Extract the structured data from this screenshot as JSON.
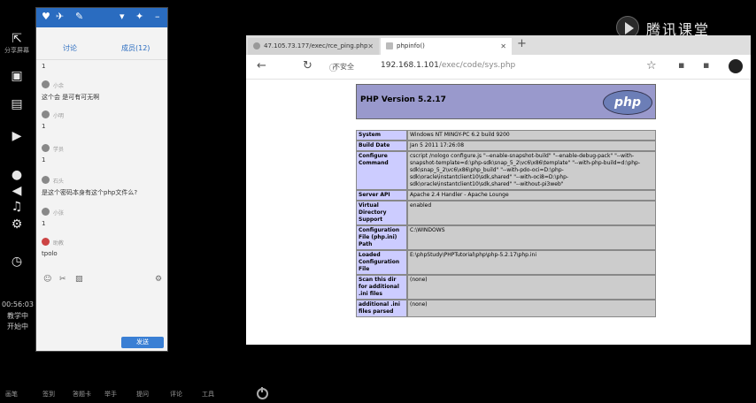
{
  "left_toolbar": {
    "share_label": "分享屏幕",
    "timer": "00:56:03",
    "status_line1": "教学中",
    "status_line2": "开始中"
  },
  "chat": {
    "tabs": [
      "讨论",
      "成员(12)"
    ],
    "messages": [
      {
        "name": "",
        "text": "1"
      },
      {
        "name": "小余",
        "text": "这个会 是可有可无啊"
      },
      {
        "name": "小明",
        "text": "1"
      },
      {
        "name": "学员",
        "text": "1"
      },
      {
        "name": "石头",
        "text": "是这个密码本身有这个php文件么?"
      },
      {
        "name": "小张",
        "text": "1"
      },
      {
        "name": "助教",
        "text": "tpolo"
      }
    ],
    "send_label": "发送"
  },
  "watermark": {
    "text": "腾讯课堂"
  },
  "browser": {
    "tab1_title": "47.105.73.177/exec/rce_ping.php",
    "tab2_title": "phpinfo()",
    "insecure_label": "不安全",
    "url_host": "192.168.1.101",
    "url_path": "/exec/code/sys.php"
  },
  "phpinfo": {
    "title": "PHP Version 5.2.17",
    "logo_text": "php",
    "rows": [
      {
        "key": "System",
        "value": "Windows NT MINGY-PC 6.2 build 9200"
      },
      {
        "key": "Build Date",
        "value": "Jan 5 2011 17:26:08"
      },
      {
        "key": "Configure Command",
        "value": "cscript /nologo configure.js \"--enable-snapshot-build\" \"--enable-debug-pack\" \"--with-snapshot-template=d:\\php-sdk\\snap_5_2\\vc6\\x86\\template\" \"--with-php-build=d:\\php-sdk\\snap_5_2\\vc6\\x86\\php_build\" \"--with-pdo-oci=D:\\php-sdk\\oracle\\instantclient10\\sdk,shared\" \"--with-oci8=D:\\php-sdk\\oracle\\instantclient10\\sdk,shared\" \"--without-pi3web\""
      },
      {
        "key": "Server API",
        "value": "Apache 2.4 Handler - Apache Lounge"
      },
      {
        "key": "Virtual Directory Support",
        "value": "enabled"
      },
      {
        "key": "Configuration File (php.ini) Path",
        "value": "C:\\WINDOWS"
      },
      {
        "key": "Loaded Configuration File",
        "value": "E:\\phpStudy\\PHPTutorial\\php\\php-5.2.17\\php.ini"
      },
      {
        "key": "Scan this dir for additional .ini files",
        "value": "(none)"
      },
      {
        "key": "additional .ini files parsed",
        "value": "(none)"
      }
    ]
  },
  "taskbar": {
    "items": [
      "画笔",
      "签到",
      "答题卡",
      "举手",
      "提问",
      "评论",
      "工具"
    ]
  },
  "colors": {
    "chat_title": "#2a6cc0",
    "php_header": "#9999cc",
    "php_key": "#ccccff",
    "php_value": "#cccccc"
  }
}
